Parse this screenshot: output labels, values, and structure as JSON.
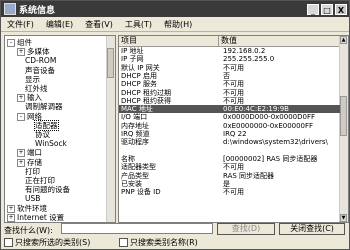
{
  "window": {
    "title": "系统信息",
    "min": "_",
    "max": "□",
    "close": "X"
  },
  "menu": [
    "文件(F)",
    "编辑(E)",
    "查看(V)",
    "工具(T)",
    "帮助(H)"
  ],
  "tree": [
    {
      "label": "组件",
      "pm": "-",
      "level": 0
    },
    {
      "label": "多媒体",
      "pm": "+",
      "level": 1
    },
    {
      "label": "CD-ROM",
      "pm": "",
      "level": 1
    },
    {
      "label": "声音设备",
      "pm": "",
      "level": 1
    },
    {
      "label": "显示",
      "pm": "",
      "level": 1
    },
    {
      "label": "红外线",
      "pm": "",
      "level": 1
    },
    {
      "label": "输入",
      "pm": "+",
      "level": 1
    },
    {
      "label": "调制解调器",
      "pm": "",
      "level": 1
    },
    {
      "label": "网络",
      "pm": "-",
      "level": 1
    },
    {
      "label": "适配器",
      "pm": "",
      "level": 2,
      "selected": true
    },
    {
      "label": "协议",
      "pm": "",
      "level": 2
    },
    {
      "label": "WinSock",
      "pm": "",
      "level": 2
    },
    {
      "label": "端口",
      "pm": "+",
      "level": 1
    },
    {
      "label": "存储",
      "pm": "+",
      "level": 1
    },
    {
      "label": "打印",
      "pm": "",
      "level": 1
    },
    {
      "label": "正在打印",
      "pm": "",
      "level": 1
    },
    {
      "label": "有问题的设备",
      "pm": "",
      "level": 1
    },
    {
      "label": "USB",
      "pm": "",
      "level": 1
    },
    {
      "label": "软件环境",
      "pm": "+",
      "level": 0
    },
    {
      "label": "Internet 设置",
      "pm": "+",
      "level": 0
    }
  ],
  "table": {
    "headers": [
      "项目",
      "数值"
    ],
    "rows": [
      [
        "IP 地址",
        "192.168.0.2"
      ],
      [
        "IP 子网",
        "255.255.255.0"
      ],
      [
        "默认 IP 网关",
        "不可用"
      ],
      [
        "DHCP 启用",
        "否"
      ],
      [
        "DHCP 服务",
        "不可用"
      ],
      [
        "DHCP 租约过期",
        "不可用"
      ],
      [
        "DHCP 租约获得",
        "不可用"
      ],
      [
        "MAC 地址",
        "00:E0:4C:E2:19:9B"
      ],
      [
        "I/O 端口",
        "0x0000D000-0x0000D0FF"
      ],
      [
        "内存地址",
        "0xE0000000-0xE00000FF"
      ],
      [
        "IRQ 频道",
        "IRQ 22"
      ],
      [
        "驱动程序",
        "d:\\windows\\system32\\drivers\\"
      ],
      [
        "",
        ""
      ],
      [
        "名称",
        "[00000002] RAS 同步适配器"
      ],
      [
        "适配器类型",
        "不可用"
      ],
      [
        "产品类型",
        "RAS 同步适配器"
      ],
      [
        "已安装",
        "是"
      ],
      [
        "PNP 设备 ID",
        "不可用"
      ]
    ],
    "selected_row": 7
  },
  "find": {
    "label": "查找什么(W):",
    "value": "",
    "find_button": "查找(D)",
    "close_find_button": "关闭查找(C)",
    "checkbox1": "只搜索所选的类别(S)",
    "checkbox2": "只搜索类别名称(R)"
  }
}
